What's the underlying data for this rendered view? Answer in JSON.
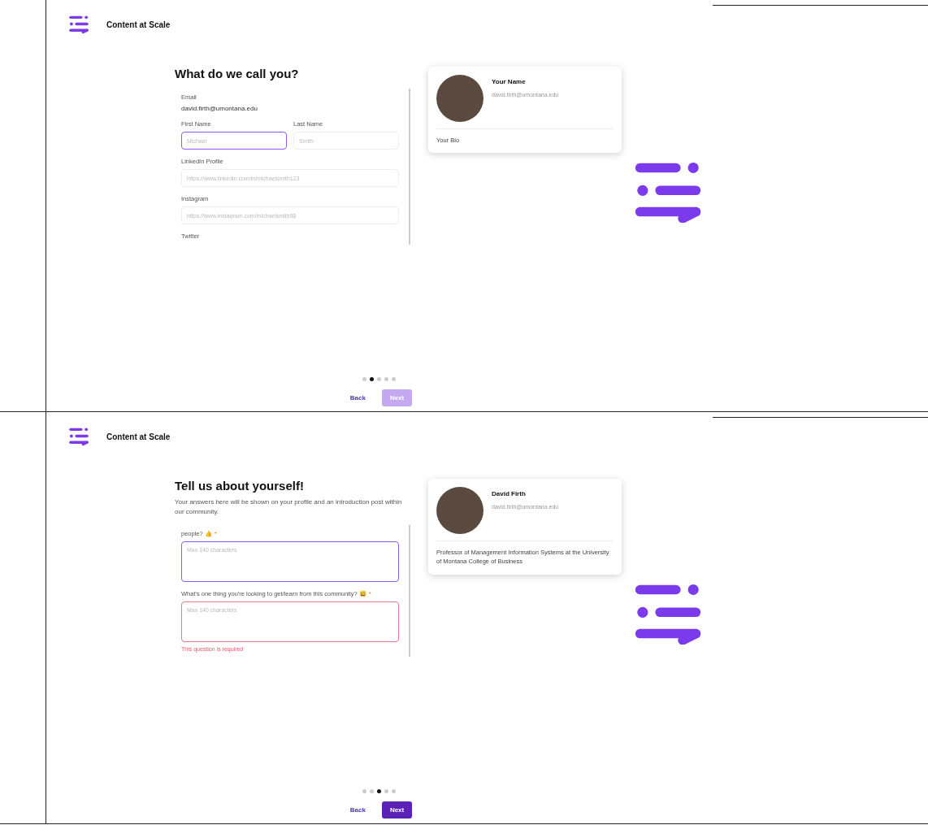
{
  "screens": [
    {
      "brand": "Content at Scale",
      "title": "What do we call you?",
      "rows": [
        [
          {
            "kind": "static",
            "label": "Email",
            "value": "david.firth@umontana.edu"
          }
        ],
        [
          {
            "kind": "input",
            "label": "First Name",
            "placeholder": "Michael",
            "focused": true,
            "error": false
          },
          {
            "kind": "input",
            "label": "Last Name",
            "placeholder": "Smith",
            "focused": false,
            "error": false
          }
        ],
        [
          {
            "kind": "input",
            "label": "LinkedIn Profile",
            "placeholder": "https://www.linkedin.com/in/michaelsmith123",
            "focused": false,
            "error": false
          }
        ],
        [
          {
            "kind": "input",
            "label": "Instagram",
            "placeholder": "https://www.instagram.com/michaelsmith98",
            "focused": false,
            "error": false
          }
        ],
        [
          {
            "kind": "label",
            "label": "Twitter"
          }
        ]
      ],
      "card": {
        "name": "Your Name",
        "email": "david.firth@umontana.edu",
        "bio": "Your Bio"
      },
      "steps": [
        {
          "selected": false
        },
        {
          "selected": true
        },
        {
          "selected": false
        },
        {
          "selected": false
        },
        {
          "selected": false
        }
      ],
      "back": "Back",
      "next": {
        "label": "Next",
        "disabled": true
      }
    },
    {
      "brand": "Content at Scale",
      "title": "Tell us about yourself!",
      "subtitle": "Your answers here will be shown on your profile and an introduction post within our community.",
      "rows": [
        [
          {
            "kind": "textarea",
            "label": "people? 👍",
            "required_mark": "*",
            "placeholder": "Max 140 characters",
            "focused": true,
            "error": false
          }
        ],
        [
          {
            "kind": "textarea",
            "label": "What's one thing you're looking to get/learn from this community? 😀",
            "required_mark": "*",
            "placeholder": "Max 140 characters",
            "focused": false,
            "error": true,
            "error_text": "This question is required"
          }
        ]
      ],
      "card": {
        "name": "David Firth",
        "email": "david.firth@umontana.edu",
        "bio": "Professor of Management Information Systems at the University of Montana College of Business"
      },
      "steps": [
        {
          "selected": false
        },
        {
          "selected": false
        },
        {
          "selected": true
        },
        {
          "selected": false
        },
        {
          "selected": false
        }
      ],
      "back": "Back",
      "next": {
        "label": "Next",
        "disabled": false
      }
    }
  ]
}
